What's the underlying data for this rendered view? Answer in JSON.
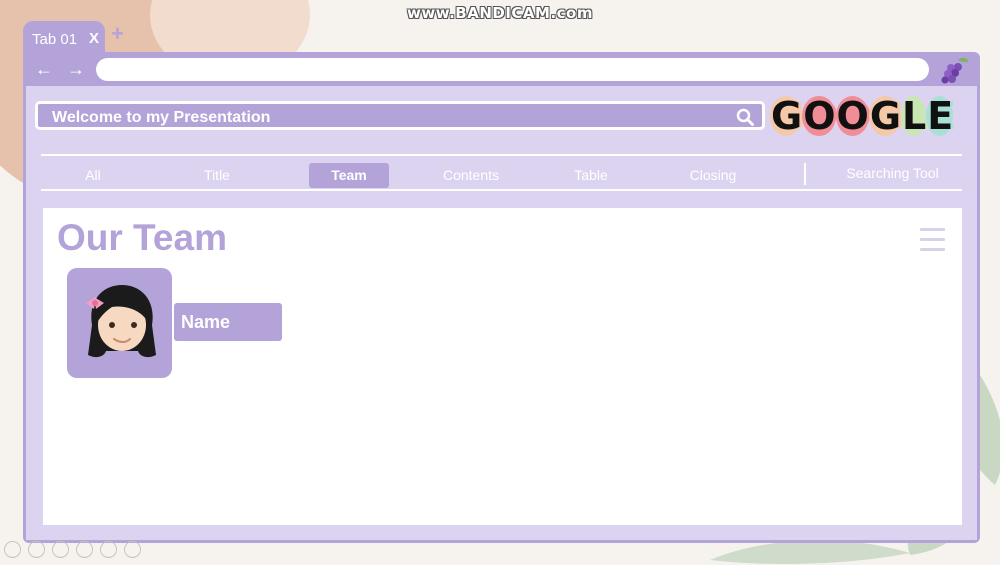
{
  "watermark": "www.BANDICAM.com",
  "tab": {
    "label": "Tab 01",
    "close": "X",
    "new_tab": "+"
  },
  "nav": {
    "back": "←",
    "forward": "→"
  },
  "search": {
    "text": "Welcome to my Presentation"
  },
  "brand": {
    "letters": [
      "G",
      "O",
      "O",
      "G",
      "L",
      "E"
    ],
    "colors": [
      "#f5c9a8",
      "#f08d96",
      "#f08d96",
      "#f5c9a8",
      "#c9e6b5",
      "#a8e0d6"
    ]
  },
  "menu": {
    "items": [
      {
        "label": "All"
      },
      {
        "label": "Title"
      },
      {
        "label": "Team",
        "active": true
      },
      {
        "label": "Contents"
      },
      {
        "label": "Table"
      },
      {
        "label": "Closing"
      }
    ],
    "tool": "Searching Tool"
  },
  "page": {
    "title": "Our Team"
  },
  "member": {
    "name": "Name"
  },
  "colors": {
    "accent": "#b3a3d9",
    "panel": "#dcd3f0",
    "background": "#f6f3ee"
  },
  "icons": [
    "grape-icon",
    "search-icon",
    "hamburger-menu-icon",
    "avatar-girl-icon"
  ]
}
